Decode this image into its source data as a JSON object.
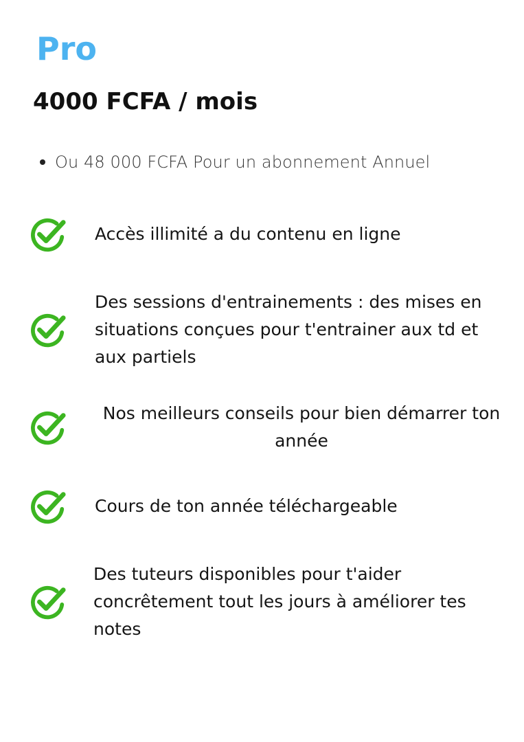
{
  "plan": {
    "name": "Pro",
    "price": "4000 FCFA / mois",
    "annual_option": "Ou 48 000 FCFA Pour un abonnement Annuel"
  },
  "features": [
    {
      "text": "Accès illimité a du contenu en ligne",
      "icon": "check-circle-icon"
    },
    {
      "text": "Des sessions d'entrainements : des mises en situations conçues pour t'entrainer aux td et aux partiels",
      "icon": "check-circle-icon"
    },
    {
      "text": "Nos meilleurs conseils pour bien démarrer ton année",
      "icon": "check-circle-icon"
    },
    {
      "text": "Cours de ton année téléchargeable",
      "icon": "check-circle-icon"
    },
    {
      "text": "Des tuteurs disponibles pour t'aider concrêtement tout les jours à améliorer tes notes",
      "icon": "check-circle-icon"
    }
  ],
  "colors": {
    "plan_name": "#4db3f0",
    "check": "#3cb521",
    "text": "#151515"
  }
}
